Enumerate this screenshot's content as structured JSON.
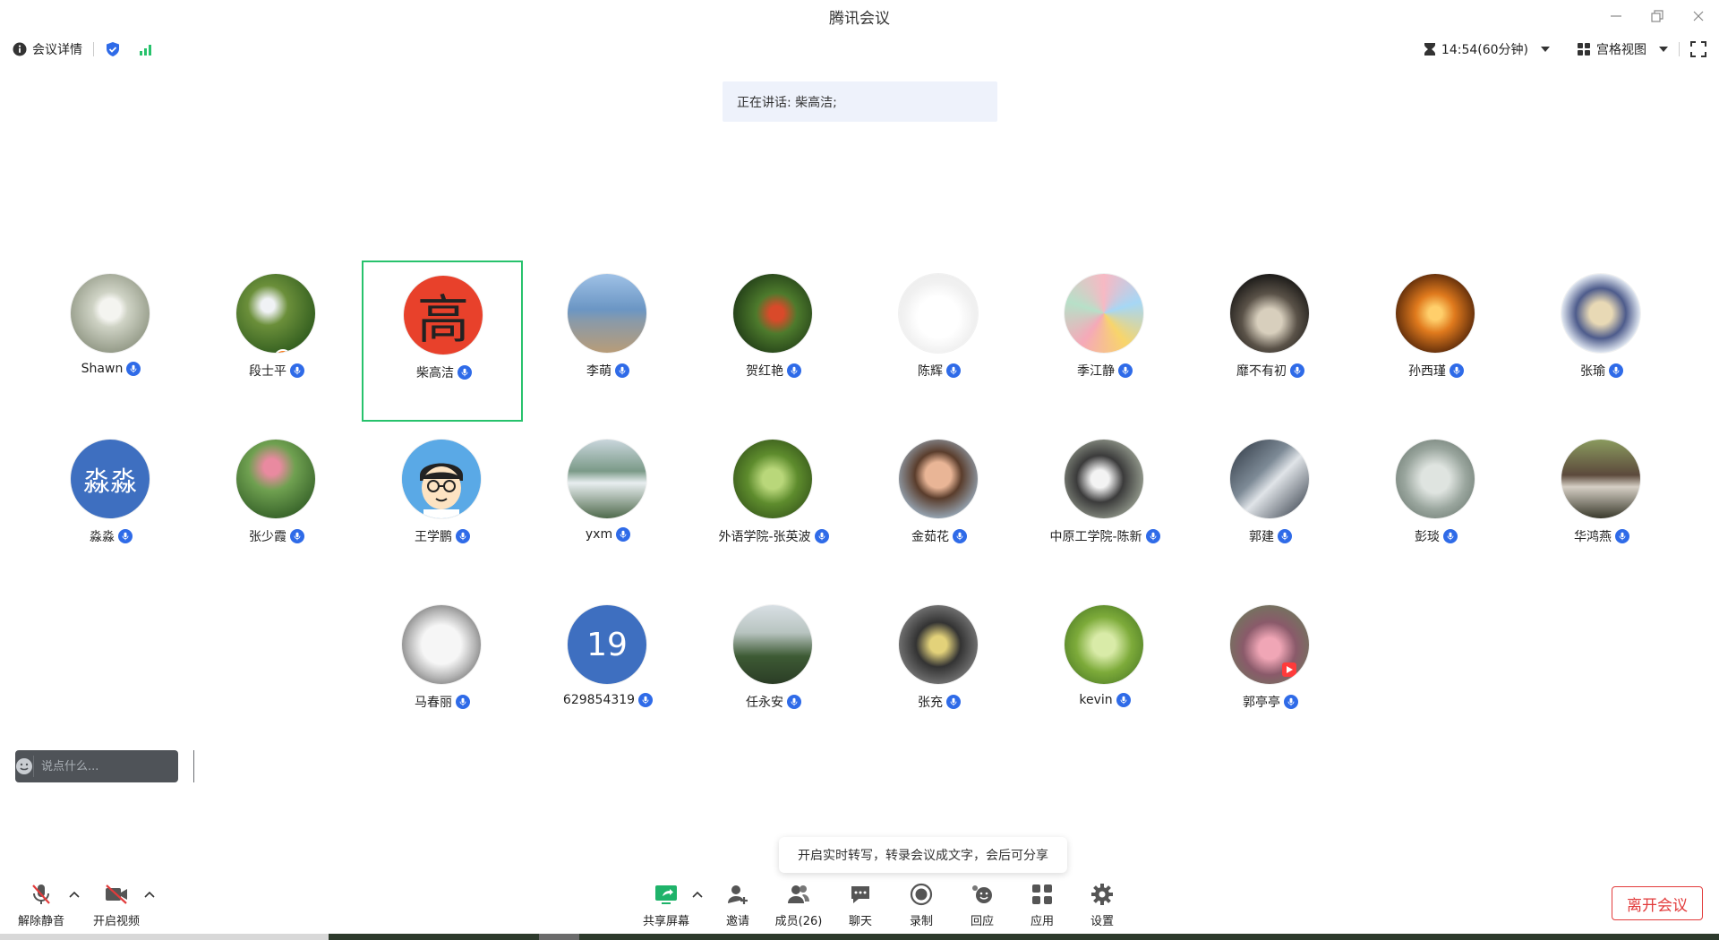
{
  "window": {
    "title": "腾讯会议"
  },
  "infobar": {
    "meeting_details_label": "会议详情",
    "timer": "14:54(60分钟)",
    "view_mode": "宫格视图"
  },
  "speaking_banner": "正在讲话: 柴高洁;",
  "participants": [
    {
      "name": "Shawn"
    },
    {
      "name": "段士平"
    },
    {
      "name": "柴高洁",
      "avatar_text": "高"
    },
    {
      "name": "李萌"
    },
    {
      "name": "贺红艳"
    },
    {
      "name": "陈辉"
    },
    {
      "name": "季江静"
    },
    {
      "name": "靡不有初"
    },
    {
      "name": "孙西瑾"
    },
    {
      "name": "张瑜"
    },
    {
      "name": "淼淼",
      "avatar_text": "淼淼"
    },
    {
      "name": "张少霞"
    },
    {
      "name": "王学鹏"
    },
    {
      "name": "yxm"
    },
    {
      "name": "外语学院-张英波"
    },
    {
      "name": "金茹花"
    },
    {
      "name": "中原工学院-陈新"
    },
    {
      "name": "郭建"
    },
    {
      "name": "彭琰"
    },
    {
      "name": "华鸿燕"
    },
    {
      "name": "马春丽"
    },
    {
      "name": "629854319",
      "avatar_text": "19"
    },
    {
      "name": "任永安"
    },
    {
      "name": "张充"
    },
    {
      "name": "kevin"
    },
    {
      "name": "郭亭亭"
    }
  ],
  "chat": {
    "placeholder": "说点什么..."
  },
  "tooltip": "开启实时转写，转录会议成文字，会后可分享",
  "toolbar": {
    "unmute": "解除静音",
    "start_video": "开启视频",
    "share_screen": "共享屏幕",
    "invite": "邀请",
    "members": "成员(26)",
    "chat": "聊天",
    "record": "录制",
    "reactions": "回应",
    "apps": "应用",
    "settings": "设置",
    "leave": "离开会议"
  },
  "colors": {
    "accent_blue": "#2f6be8",
    "active_border": "#27c26c",
    "leave_red": "#e23b3b",
    "speaking_bg": "#eef2fb"
  }
}
